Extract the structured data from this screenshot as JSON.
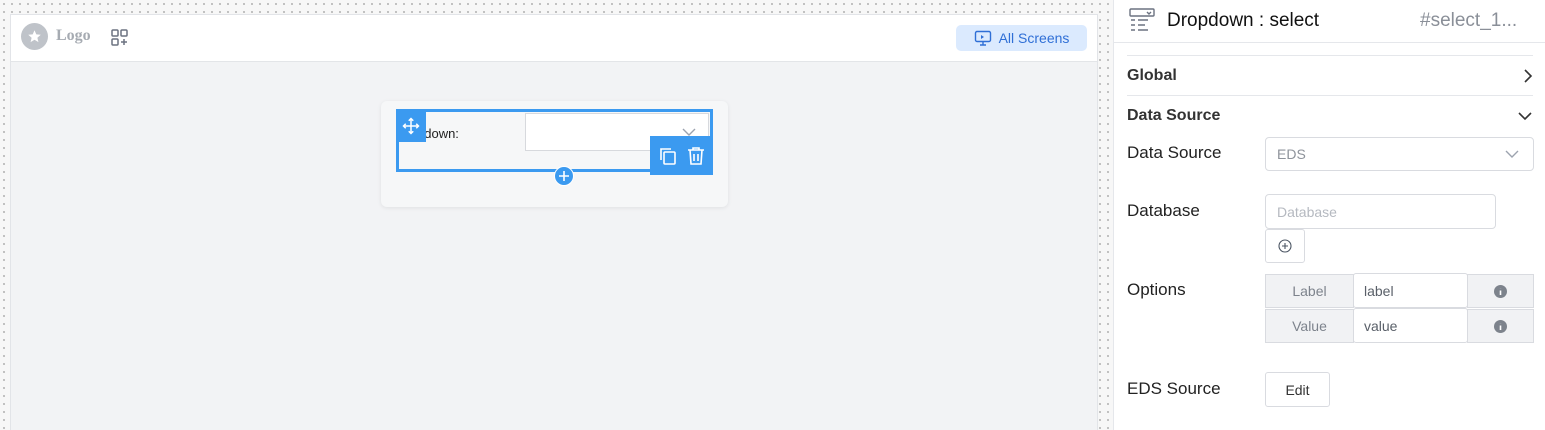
{
  "canvas": {
    "logo_text": "Logo",
    "all_screens_label": "All Screens",
    "component": {
      "label": "odown:",
      "icons": [
        "move-icon",
        "chevron-down-icon",
        "copy-icon",
        "delete-icon",
        "plus-icon"
      ]
    }
  },
  "panel": {
    "title": "Dropdown : select",
    "component_id": "#select_1...",
    "sections": {
      "global": "Global",
      "data_source": "Data Source"
    },
    "fields": {
      "data_source_label": "Data Source",
      "data_source_value": "EDS",
      "database_label": "Database",
      "database_placeholder": "Database",
      "options_label": "Options",
      "options": [
        {
          "key": "Label",
          "value": "label"
        },
        {
          "key": "Value",
          "value": "value"
        }
      ],
      "eds_source_label": "EDS Source",
      "edit_button": "Edit"
    }
  },
  "colors": {
    "accent": "#3b9af0",
    "all_screens_bg": "#dbeafe",
    "all_screens_text": "#2f6fd6"
  }
}
